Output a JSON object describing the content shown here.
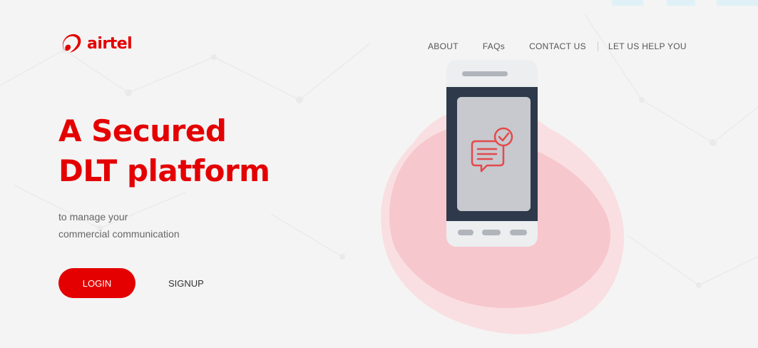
{
  "header": {
    "logo_text": "airtel",
    "nav": [
      {
        "label": "ABOUT"
      },
      {
        "label": "FAQs"
      },
      {
        "label": "CONTACT US"
      },
      {
        "label": "LET US HELP YOU"
      }
    ]
  },
  "hero": {
    "headline_line1": "A Secured",
    "headline_line2": "DLT platform",
    "tagline_line1": "to manage your",
    "tagline_line2": "commercial communication",
    "login_label": "LOGIN",
    "signup_label": "SIGNUP"
  },
  "colors": {
    "brand_red": "#e40000",
    "blob_pink": "#f7c9cd",
    "phone_frame": "#2e3a4b",
    "phone_screen": "#c7c9cf"
  },
  "icons": {
    "logo": "airtel-logo-icon",
    "phone": "smartphone-illustration",
    "message": "chat-checkmark-icon"
  }
}
